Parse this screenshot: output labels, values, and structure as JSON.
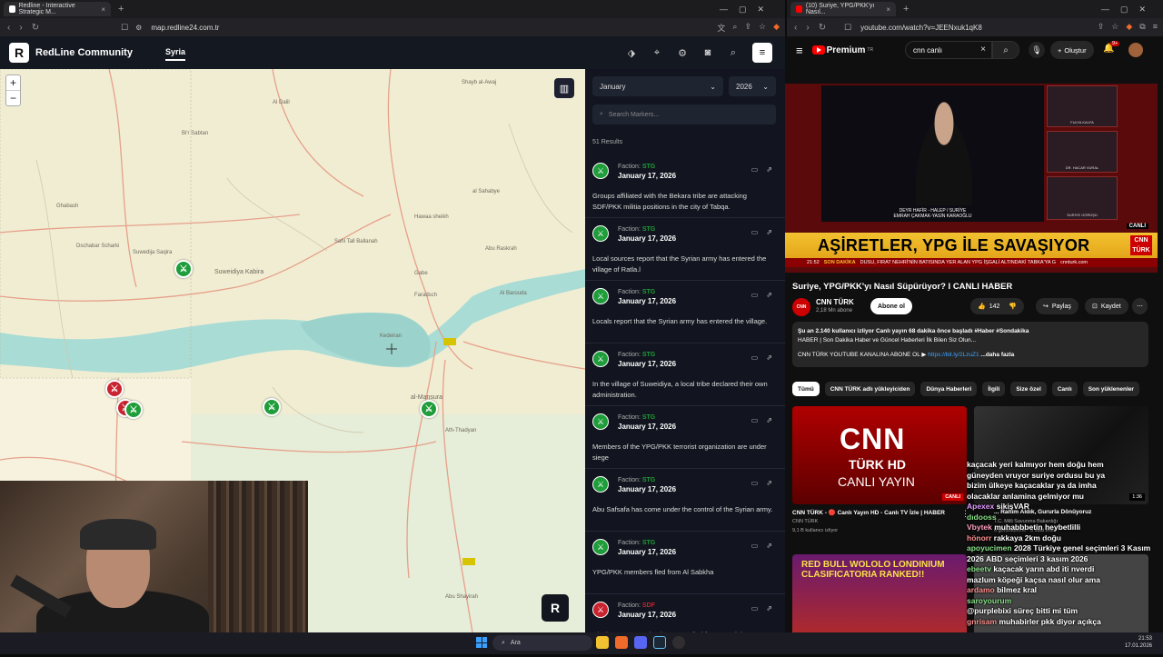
{
  "left_browser": {
    "tab_title": "Redline - Interactive Strategic M...",
    "url": "map.redline24.com.tr"
  },
  "right_browser": {
    "tab_title": "(10) Suriye, YPG/PKK'yı Nasıl...",
    "url": "youtube.com/watch?v=JEENxuk1qK8"
  },
  "redline": {
    "brand": "RedLine Community",
    "region_tab": "Syria",
    "map_icon": "map-book-icon",
    "month": "January",
    "year": "2026",
    "search_placeholder": "Search Markers...",
    "results": "51 Results",
    "faction_label": "Faction:",
    "colors": {
      "stg": "#1f9d3a",
      "sdf": "#c9232f",
      "panel": "#12151f",
      "map": "#f1edd3"
    },
    "map_labels": [
      "Shayb al-Awaj",
      "Shayb al-Awaj",
      "Bi'r Sabtan",
      "Al Dalil",
      "Ghabash",
      "Dschabar Scharki",
      "Suwedija Saqira",
      "Suweidiya Kabira",
      "Sahl Tall Ballanah",
      "Sahl Sahin",
      "Kedeiran",
      "Abu Raskrah",
      "Al Barouda",
      "al-Mansura",
      "al-Mansura",
      "Ath-Thadyan",
      "Abu Shayirah",
      "Mahmoudiya",
      "Rasm al Ahmar",
      "al Sahabye",
      "Hawaa sheikh",
      "Faradsch",
      "Gabe"
    ],
    "items": [
      {
        "faction": "STG",
        "date": "January 17, 2026",
        "desc": "Groups affiliated with the Bekara tribe are attacking SDF/PKK militia positions in the city of Tabqa.",
        "color": "stg"
      },
      {
        "faction": "STG",
        "date": "January 17, 2026",
        "desc": "Local sources report that the Syrian army has entered the village of Ratla.l",
        "color": "stg"
      },
      {
        "faction": "STG",
        "date": "January 17, 2026",
        "desc": "Locals report that the Syrian army has entered the village.",
        "color": "stg"
      },
      {
        "faction": "STG",
        "date": "January 17, 2026",
        "desc": "In the village of Suweidiya, a local tribe declared their own administration.",
        "color": "stg"
      },
      {
        "faction": "STG",
        "date": "January 17, 2026",
        "desc": "Members of the YPG/PKK terrorist organization are under siege",
        "color": "stg"
      },
      {
        "faction": "STG",
        "date": "January 17, 2026",
        "desc": "Abu Safsafa has come under the control of the Syrian army.",
        "color": "stg"
      },
      {
        "faction": "STG",
        "date": "January 17, 2026",
        "desc": "YPG/PKK members fled from Al Sabkha",
        "color": "stg"
      },
      {
        "faction": "SDF",
        "date": "January 17, 2026",
        "desc": "Clashes are occurring between tribal forces and the",
        "color": "sdf"
      }
    ]
  },
  "youtube": {
    "premium": "Premium",
    "premium_sup": "TR",
    "search_value": "cnn canlı",
    "create": "Oluştur",
    "notif": "9+",
    "banner": "AŞİRETLER, YPG İLE SAVAŞIYOR",
    "banner_logo": "CNN TÜRK",
    "canli_badge": "CANLI",
    "ticker_time": "21:52",
    "ticker_tag": "SON DAKİKA",
    "ticker_text": "DUSU, FIRAT NEHRİ'NİN BATISINDA YER ALAN YPG İŞGALİ ALTINDAKİ TABKA'YA G",
    "ticker_site": "cnnturk.com",
    "caption_line1": "DEYR HAFİR - HALEP / SURİYE",
    "caption_line2": "EMRAH ÇAKMAK-YASİN KARAOĞLU",
    "side1": "FULYA KALFA",
    "side2": "DR. HACAR VURAL",
    "side3": "SURİYE GÖRÜŞÜ",
    "video_title": "Suriye, YPG/PKK'yı Nasıl Süpürüyor? I CANLI HABER",
    "channel": "CNN TÜRK",
    "subs": "2,18 Mn abone",
    "subscribe": "Abone ol",
    "likes": "142",
    "share": "Paylaş",
    "save": "Kaydet",
    "desc_line1": "Şu an 2.140 kullanıcı izliyor  Canlı yayın 68 dakika önce başladı  #Haber #Sondakika",
    "desc_line2": "HABER | Son Dakika Haber ve Güncel Haberleri İlk Bilen Siz Olun...",
    "desc_line3": "CNN TÜRK YOUTUBE KANALINA ABONE OL ▶",
    "desc_link": "https://bit.ly/2LzuZ1",
    "desc_more": "...daha fazla",
    "chips": [
      "Tümü",
      "CNN TÜRK adlı yükleyiciden",
      "Dünya Haberleri",
      "İlgili",
      "Size özel",
      "Canlı",
      "Son yüklenenler"
    ],
    "rec1_title": "CNN TÜRK - 🔴 Canlı Yayın HD - Canlı TV İzle | HABER",
    "rec1_channel": "CNN TÜRK",
    "rec1_views": "9,1 B kullanıcı izliyor",
    "rec1_thumb": [
      "CNN",
      "TÜRK HD",
      "CANLI YAYIN"
    ],
    "rec1_live": "CANLI",
    "rec2_title": "... Rahim Aldık, Gururla Dönüyoruz",
    "rec2_channel": "T.C. Milli Savunma Bakanlığı",
    "rec2_views": "6 görüntüleme · 3 saat önce",
    "rec2_dur": "1:36",
    "rec3_thumb": "RED BULL WOLOLO LONDINIUM CLASIFICATORIA RANKED!!"
  },
  "chat": [
    {
      "u": "",
      "m": "kaçacak yeri kalmıyor hem doğu hem"
    },
    {
      "u": "",
      "m": "güneyden vruyor suriye ordusu bu ya"
    },
    {
      "u": "",
      "m": "bizim ülkeye kaçacaklar ya da imha"
    },
    {
      "u": "",
      "m": "olacaklar anlamina gelmiyor mu"
    },
    {
      "u": "Apexex",
      "m": "sikişVAR"
    },
    {
      "u": "dıdooss",
      "m": ""
    },
    {
      "u": "Vbytek",
      "m": "muhabbbetin heybetlilli"
    },
    {
      "u": "hönorr",
      "m": "rakkaya 2km doğu"
    },
    {
      "u": "apoyucimen",
      "m": "2028 Türkiye genel seçimleri 3 Kasım"
    },
    {
      "u": "",
      "m": "2026 ABD seçimleri 3 kasım 2026"
    },
    {
      "u": "ebeetv",
      "m": "kaçacak yarın abd iti nverdi"
    },
    {
      "u": "",
      "m": "mazlum köpeği kaçsa nasıl olur ama"
    },
    {
      "u": "ardamo",
      "m": "bilmez kral"
    },
    {
      "u": "saroyourum",
      "m": ""
    },
    {
      "u": "",
      "m": "@purplebixi süreç bitti mi tüm"
    },
    {
      "u": "gnrisam",
      "m": "muhabirler pkk diyor açıkça"
    }
  ],
  "taskbar": {
    "search": "Ara",
    "time": "21:53",
    "date": "17.01.2026"
  }
}
